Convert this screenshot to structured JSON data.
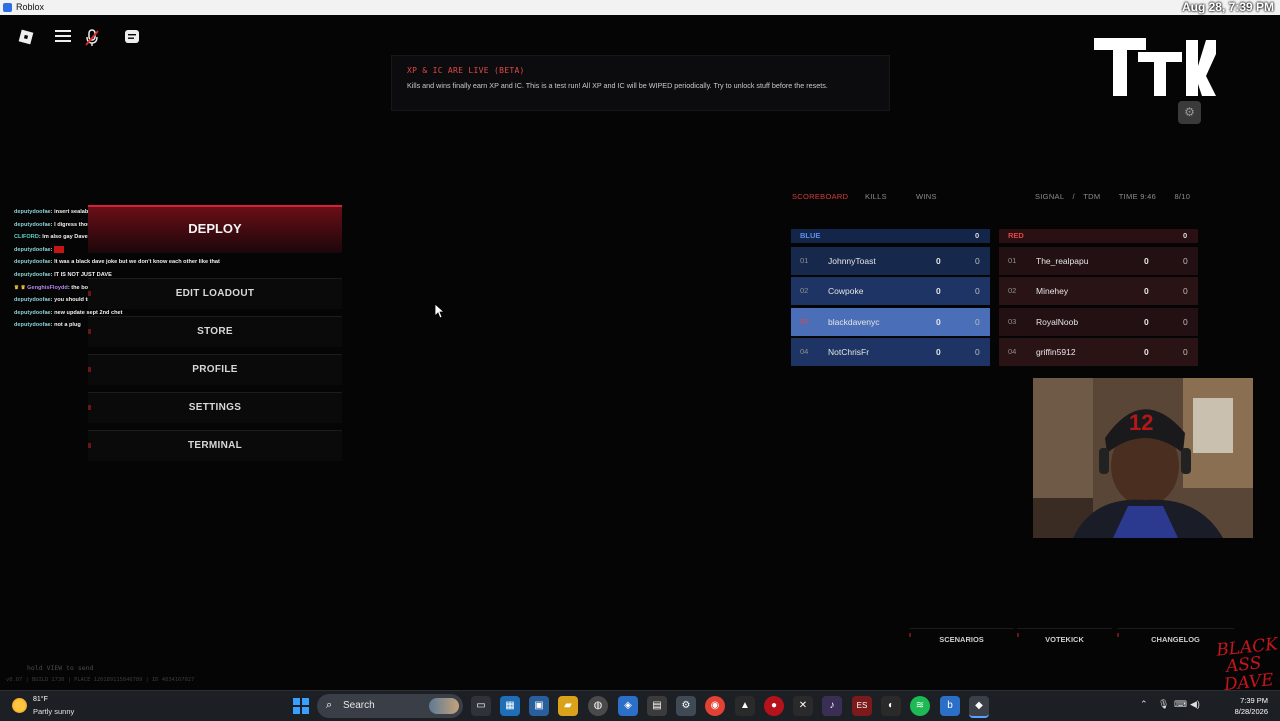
{
  "window": {
    "title": "Roblox"
  },
  "overlay": {
    "timestamp": "Aug 28, 7:39 PM"
  },
  "notice": {
    "title": "XP & IC ARE LIVE (BETA)",
    "body": "Kills and wins finally earn XP and IC. This is a test run! All XP and IC will be WIPED periodically. Try to unlock stuff before the resets."
  },
  "logo": {
    "text": "TTK"
  },
  "chat": [
    {
      "user": "deputydoofae",
      "msg": "insert sealab joke here",
      "style": "c1"
    },
    {
      "user": "deputydoofae",
      "msg": "I digress though hopefully juicy gets right",
      "style": "c1"
    },
    {
      "user": "CLIFORD",
      "msg": "Im also gay Dave",
      "style": "c2"
    },
    {
      "user": "deputydoofae",
      "msg": "",
      "style": "c1",
      "red_block": true
    },
    {
      "user": "deputydoofae",
      "msg": "It was a black dave joke but we don't know each other like that",
      "style": "c1"
    },
    {
      "user": "deputydoofae",
      "msg": "IT IS NOT JUST DAVE",
      "style": "c1"
    },
    {
      "user": "GenghisFloydd",
      "msg": "the bolt action is OP I think u gotta play a while for it the",
      "style": "c3",
      "badges": true
    },
    {
      "user": "deputydoofae",
      "msg": "you should try bodycam",
      "style": "c1"
    },
    {
      "user": "deputydoofae",
      "msg": "new update sept 2nd chet",
      "style": "c1"
    },
    {
      "user": "deputydoofae",
      "msg": "not a plug",
      "style": "c1"
    }
  ],
  "menu": {
    "deploy": "DEPLOY",
    "edit_loadout": "EDIT LOADOUT",
    "store": "STORE",
    "profile": "PROFILE",
    "settings": "SETTINGS",
    "terminal": "TERMINAL"
  },
  "scoreboard": {
    "tabs": [
      "SCOREBOARD",
      "KILLS",
      "WINS"
    ],
    "mode": "SIGNAL",
    "separator": "/",
    "gametype": "TDM",
    "time": "TIME 9:46",
    "players": "8/10",
    "blue": {
      "name": "BLUE",
      "score": "0",
      "color": "#3b6fd4",
      "rows": [
        {
          "num": "01",
          "name": "JohnnyToast",
          "k": "0",
          "d": "0"
        },
        {
          "num": "02",
          "name": "Cowpoke",
          "k": "0",
          "d": "0"
        },
        {
          "num": "03",
          "name": "blackdavenyc",
          "k": "0",
          "d": "0",
          "highlight": true
        },
        {
          "num": "04",
          "name": "NotChrisFr",
          "k": "0",
          "d": "0"
        }
      ]
    },
    "red": {
      "name": "RED",
      "score": "0",
      "color": "#d23b3b",
      "rows": [
        {
          "num": "01",
          "name": "The_realpapu",
          "k": "0",
          "d": "0"
        },
        {
          "num": "02",
          "name": "Minehey",
          "k": "0",
          "d": "0"
        },
        {
          "num": "03",
          "name": "RoyalNoob",
          "k": "0",
          "d": "0"
        },
        {
          "num": "04",
          "name": "griffin5912",
          "k": "0",
          "d": "0"
        }
      ]
    }
  },
  "bottom": {
    "scenarios": "SCENARIOS",
    "votekick": "VOTEKICK",
    "changelog": "CHANGELOG"
  },
  "hint": "hold VIEW to send",
  "build": "v0.07 | BUILD 1730 | PLACE 120189115846789 | ID 4834167027",
  "watermark": [
    "BLACK",
    "ASS",
    "DAVE"
  ],
  "taskbar": {
    "weather_temp": "81°F",
    "weather_desc": "Partly sunny",
    "search": "Search",
    "time": "7:39 PM",
    "date": "8/28/2026"
  },
  "colors": {
    "accent": "#d4223a",
    "blue_team": "#1a2e52",
    "red_team": "#2a1214",
    "highlight": "#4a6fb8"
  }
}
